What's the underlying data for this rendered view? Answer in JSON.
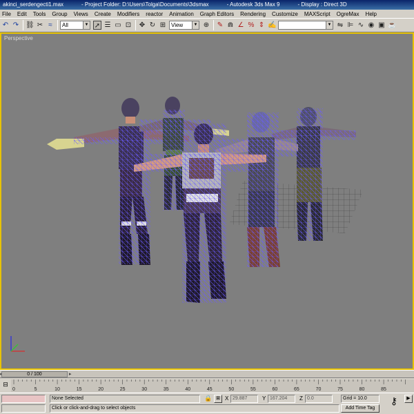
{
  "window": {
    "file": "akinci_serdengecti1.max",
    "project": "- Project Folder: D:\\Users\\Tolga\\Documents\\3dsmax",
    "app": "- Autodesk 3ds Max 9",
    "display": "- Display : Direct 3D"
  },
  "menu": [
    "File",
    "Edit",
    "Tools",
    "Group",
    "Views",
    "Create",
    "Modifiers",
    "reactor",
    "Animation",
    "Graph Editors",
    "Rendering",
    "Customize",
    "MAXScript",
    "OgreMax",
    "Help"
  ],
  "toolbar": {
    "selection_filter": "All",
    "ref_coord": "View",
    "named_selection": ""
  },
  "viewport": {
    "label": "Perspective",
    "border_color": "#e8c300",
    "background": "#7f7f7f",
    "wire_color": "#6a5cff"
  },
  "timeline": {
    "frame_display": "0 / 100",
    "ticks": [
      "0",
      "5",
      "10",
      "15",
      "20",
      "25",
      "30",
      "35",
      "40",
      "45",
      "50",
      "55",
      "60",
      "65",
      "70",
      "75",
      "80",
      "85"
    ]
  },
  "status": {
    "selection": "None Selected",
    "prompt": "Click or click-and-drag to select objects",
    "x_label": "X",
    "x_value": "29.887",
    "y_label": "Y",
    "y_value": "167.204",
    "z_label": "Z",
    "z_value": "0.0",
    "grid": "Grid = 10.0",
    "add_time_tag": "Add Time Tag"
  }
}
